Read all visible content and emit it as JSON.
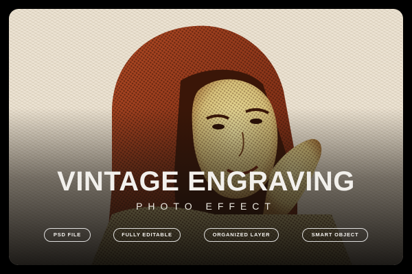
{
  "title": "VINTAGE ENGRAVING",
  "subtitle": "PHOTO EFFECT",
  "badges": [
    "PSD FILE",
    "FULLY EDITABLE",
    "ORGANIZED LAYER",
    "SMART OBJECT"
  ],
  "colors": {
    "background": "#000000",
    "paper": "#ece3d3",
    "engraving_dark": "#7a2c14",
    "engraving_light": "#e9dd9a",
    "text": "#f2f0ec"
  }
}
